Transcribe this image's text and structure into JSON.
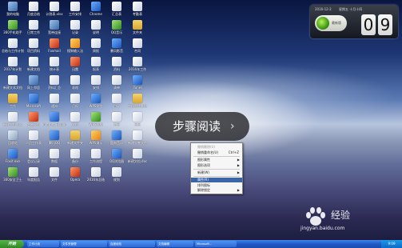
{
  "desktop": {
    "icons": [
      {
        "label": "我的电脑",
        "kind": "app-pc"
      },
      {
        "label": "360手机助手",
        "kind": "app-green"
      },
      {
        "label": "总结与工作计划",
        "kind": "doc"
      },
      {
        "label": "2017年计划",
        "kind": "doc"
      },
      {
        "label": "新建文本文档",
        "kind": "doc"
      },
      {
        "label": "工作",
        "kind": "folder"
      },
      {
        "label": "新建文档.doc",
        "kind": "doc"
      },
      {
        "label": "回收站",
        "kind": "app-recycle"
      },
      {
        "label": "Foxit.exe",
        "kind": "app-blue"
      },
      {
        "label": "360安全卫士",
        "kind": "app-green"
      },
      {
        "label": "月度总结",
        "kind": "doc"
      },
      {
        "label": "日常工作",
        "kind": "doc"
      },
      {
        "label": "项目资料",
        "kind": "doc"
      },
      {
        "label": "新建文档",
        "kind": "doc"
      },
      {
        "label": "网上邻居",
        "kind": "app-pc"
      },
      {
        "label": "Microsoft",
        "kind": "app-blue"
      },
      {
        "label": "名单表格",
        "kind": "app-red"
      },
      {
        "label": "人员工作表",
        "kind": "doc"
      },
      {
        "label": "会议记录",
        "kind": "doc"
      },
      {
        "label": "年度报告",
        "kind": "doc"
      },
      {
        "label": "计划表.xlsx",
        "kind": "doc"
      },
      {
        "label": "宽带连接",
        "kind": "app-pc"
      },
      {
        "label": "Foxmail",
        "kind": "app-red"
      },
      {
        "label": "统计表",
        "kind": "doc"
      },
      {
        "label": "资料汇总",
        "kind": "doc"
      },
      {
        "label": "通知",
        "kind": "doc"
      },
      {
        "label": "Internet Explorer",
        "kind": "app-blue"
      },
      {
        "label": "腾讯QQ",
        "kind": "app-blue"
      },
      {
        "label": "数据",
        "kind": "doc"
      },
      {
        "label": "文件",
        "kind": "doc"
      },
      {
        "label": "工作安排",
        "kind": "doc"
      },
      {
        "label": "记录",
        "kind": "doc"
      },
      {
        "label": "搜狗输入法",
        "kind": "app-orange"
      },
      {
        "label": "迅雷",
        "kind": "app-red"
      },
      {
        "label": "表格",
        "kind": "doc"
      },
      {
        "label": "月报",
        "kind": "doc"
      },
      {
        "label": "文档",
        "kind": "doc"
      },
      {
        "label": "新建文件夹",
        "kind": "folder"
      },
      {
        "label": "备份",
        "kind": "doc"
      },
      {
        "label": "Opera",
        "kind": "app-red"
      },
      {
        "label": "Chrome",
        "kind": "app-blue"
      },
      {
        "label": "说明",
        "kind": "doc"
      },
      {
        "label": "周报",
        "kind": "doc"
      },
      {
        "label": "报表",
        "kind": "doc"
      },
      {
        "label": "安排",
        "kind": "doc"
      },
      {
        "label": "WPS文字",
        "kind": "app-blue"
      },
      {
        "label": "WPS表格",
        "kind": "app-green"
      },
      {
        "label": "WPS演示",
        "kind": "app-orange"
      },
      {
        "label": "工作流程",
        "kind": "doc"
      },
      {
        "label": "2016年总结",
        "kind": "doc"
      },
      {
        "label": "汇总表",
        "kind": "doc"
      },
      {
        "label": "QQ音乐",
        "kind": "app-green"
      },
      {
        "label": "暴风影音",
        "kind": "app-blue"
      },
      {
        "label": "资料",
        "kind": "doc"
      },
      {
        "label": "清单",
        "kind": "doc"
      },
      {
        "label": "目录",
        "kind": "doc"
      },
      {
        "label": "名册",
        "kind": "doc"
      },
      {
        "label": "酷狗音乐",
        "kind": "app-blue"
      },
      {
        "label": "QQ浏览器",
        "kind": "app-blue"
      },
      {
        "label": "规划",
        "kind": "doc"
      },
      {
        "label": "考勤表",
        "kind": "doc"
      },
      {
        "label": "文件夹",
        "kind": "folder"
      },
      {
        "label": "合同",
        "kind": "doc"
      },
      {
        "label": "2016年工作",
        "kind": "doc"
      },
      {
        "label": "iTunes",
        "kind": "app-blue"
      },
      {
        "label": "工作图片素材",
        "kind": "folder"
      },
      {
        "label": "日历",
        "kind": "doc"
      },
      {
        "label": "新建一卷文件",
        "kind": "doc"
      },
      {
        "label": "新建文档.doc",
        "kind": "doc"
      }
    ]
  },
  "clock": {
    "date": "2016-12-2",
    "day": "星期五 十月十四",
    "ball_text": "最新版",
    "digit1": "0",
    "digit2": "9"
  },
  "overlay": {
    "label": "步骤阅读",
    "arrow": "›"
  },
  "context_menu": {
    "items": [
      {
        "label": "撤销删除(U)",
        "shortcut": "",
        "disabled": true
      },
      {
        "label": "撤销重命名(U)",
        "shortcut": "Ctrl+Z",
        "disabled": false
      },
      {
        "label": "图形属性",
        "shortcut": "",
        "submenu": true
      },
      {
        "label": "图形选项",
        "shortcut": "",
        "submenu": true
      },
      {
        "label": "新建(W)",
        "shortcut": "",
        "submenu": true
      },
      {
        "label": "属性(R)",
        "shortcut": "",
        "highlighted": true
      },
      {
        "label": "排列图标",
        "shortcut": ""
      },
      {
        "label": "解除锁定",
        "shortcut": "",
        "submenu": true
      }
    ]
  },
  "taskbar": {
    "start": "开始",
    "buttons": [
      "工作计划",
      "文件夹管理",
      "百度经验",
      "文档编辑",
      "Microsoft..."
    ],
    "tray": "9:09"
  },
  "watermark": {
    "brand": "经验",
    "url": "jingyan.baidu.com"
  }
}
